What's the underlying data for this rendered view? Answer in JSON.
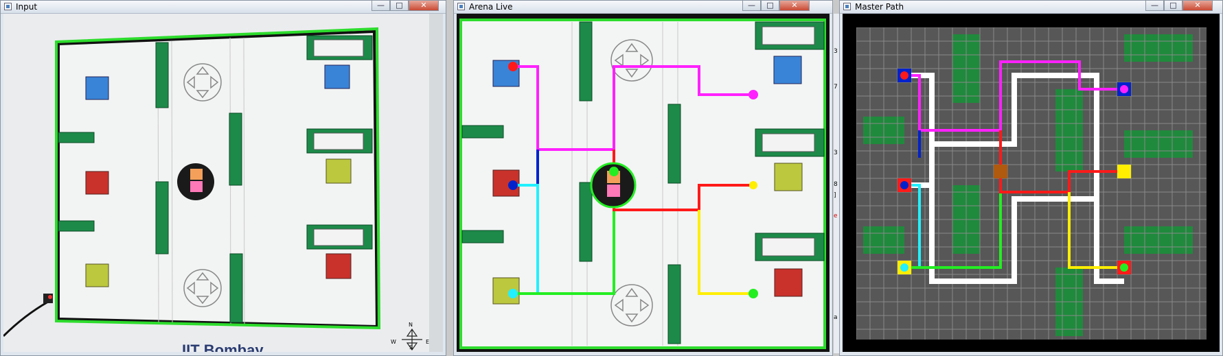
{
  "windows": {
    "input": {
      "title": "Input",
      "buttons": {
        "minimize": "—",
        "maximize": "□",
        "close": "✕"
      },
      "footer_text": "IIT Bombay",
      "compass": {
        "n": "N",
        "w": "W",
        "e": "E",
        "s": "S"
      }
    },
    "arena": {
      "title": "Arena Live",
      "buttons": {
        "minimize": "—",
        "maximize": "□",
        "close": "✕"
      }
    },
    "master": {
      "title": "Master Path",
      "buttons": {
        "minimize": "—",
        "maximize": "□",
        "close": "✕"
      },
      "side_glyphs": [
        "3",
        "7",
        "3",
        "8",
        "]",
        "e",
        "a"
      ]
    }
  },
  "colors": {
    "magenta": "#ff22ff",
    "red": "#ff1a1a",
    "blue": "#0022cc",
    "cyan": "#22f0ff",
    "green": "#22ee22",
    "yellow": "#ffee00",
    "white": "#ffffff",
    "grid_bg": "#575757",
    "grid_tile": "#0a8a0a",
    "border": "#000000",
    "block_blue": "#3a84d8",
    "block_red": "#c8322a",
    "block_yellow": "#bcc83e"
  },
  "icons": [
    "app-icon",
    "minimize-icon",
    "maximize-icon",
    "close-icon",
    "compass-icon",
    "direction-arrows-icon"
  ]
}
